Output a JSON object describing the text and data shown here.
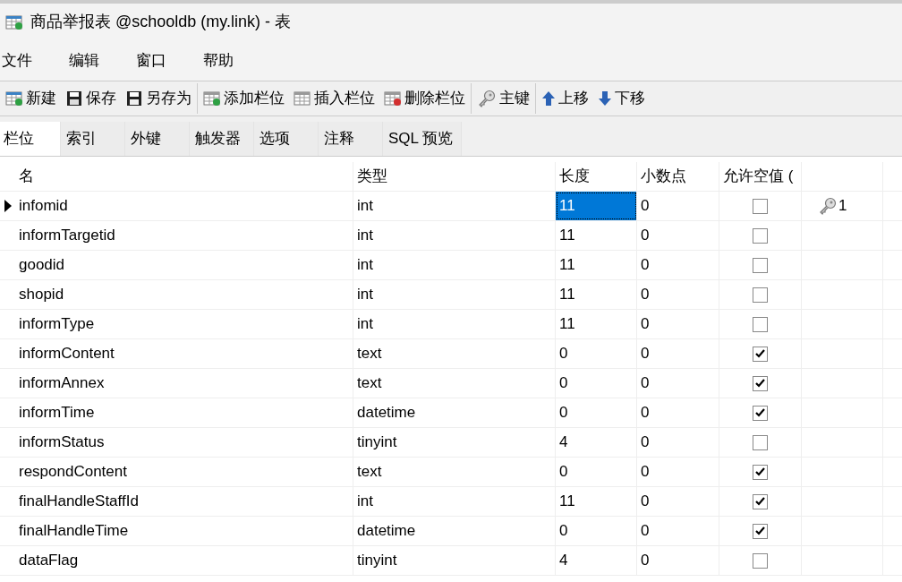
{
  "window": {
    "title": "商品举报表 @schooldb (my.link) - 表"
  },
  "menu": [
    "文件",
    "编辑",
    "窗口",
    "帮助"
  ],
  "toolbar": {
    "groups": [
      [
        "新建",
        "保存",
        "另存为"
      ],
      [
        "添加栏位",
        "插入栏位",
        "删除栏位"
      ],
      [
        "主键"
      ],
      [
        "上移",
        "下移"
      ]
    ]
  },
  "tabs": [
    {
      "label": "栏位",
      "selected": true
    },
    {
      "label": "索引",
      "selected": false
    },
    {
      "label": "外键",
      "selected": false
    },
    {
      "label": "触发器",
      "selected": false
    },
    {
      "label": "选项",
      "selected": false
    },
    {
      "label": "注释",
      "selected": false
    },
    {
      "label": "SQL 预览",
      "selected": false
    }
  ],
  "table": {
    "columns": [
      "名",
      "类型",
      "长度",
      "小数点",
      "允许空值 ("
    ],
    "rows": [
      {
        "name": "infomid",
        "type": "int",
        "length": "11",
        "decimals": "0",
        "nullable": false,
        "key": "1",
        "selected": true
      },
      {
        "name": "informTargetid",
        "type": "int",
        "length": "11",
        "decimals": "0",
        "nullable": false,
        "selected": false
      },
      {
        "name": "goodid",
        "type": "int",
        "length": "11",
        "decimals": "0",
        "nullable": false,
        "selected": false
      },
      {
        "name": "shopid",
        "type": "int",
        "length": "11",
        "decimals": "0",
        "nullable": false,
        "selected": false
      },
      {
        "name": "informType",
        "type": "int",
        "length": "11",
        "decimals": "0",
        "nullable": false,
        "selected": false
      },
      {
        "name": "informContent",
        "type": "text",
        "length": "0",
        "decimals": "0",
        "nullable": true,
        "selected": false
      },
      {
        "name": "informAnnex",
        "type": "text",
        "length": "0",
        "decimals": "0",
        "nullable": true,
        "selected": false
      },
      {
        "name": "informTime",
        "type": "datetime",
        "length": "0",
        "decimals": "0",
        "nullable": true,
        "selected": false
      },
      {
        "name": "informStatus",
        "type": "tinyint",
        "length": "4",
        "decimals": "0",
        "nullable": false,
        "selected": false
      },
      {
        "name": "respondContent",
        "type": "text",
        "length": "0",
        "decimals": "0",
        "nullable": true,
        "selected": false
      },
      {
        "name": "finalHandleStaffId",
        "type": "int",
        "length": "11",
        "decimals": "0",
        "nullable": true,
        "selected": false
      },
      {
        "name": "finalHandleTime",
        "type": "datetime",
        "length": "0",
        "decimals": "0",
        "nullable": true,
        "selected": false
      },
      {
        "name": "dataFlag",
        "type": "tinyint",
        "length": "4",
        "decimals": "0",
        "nullable": false,
        "selected": false
      }
    ]
  }
}
